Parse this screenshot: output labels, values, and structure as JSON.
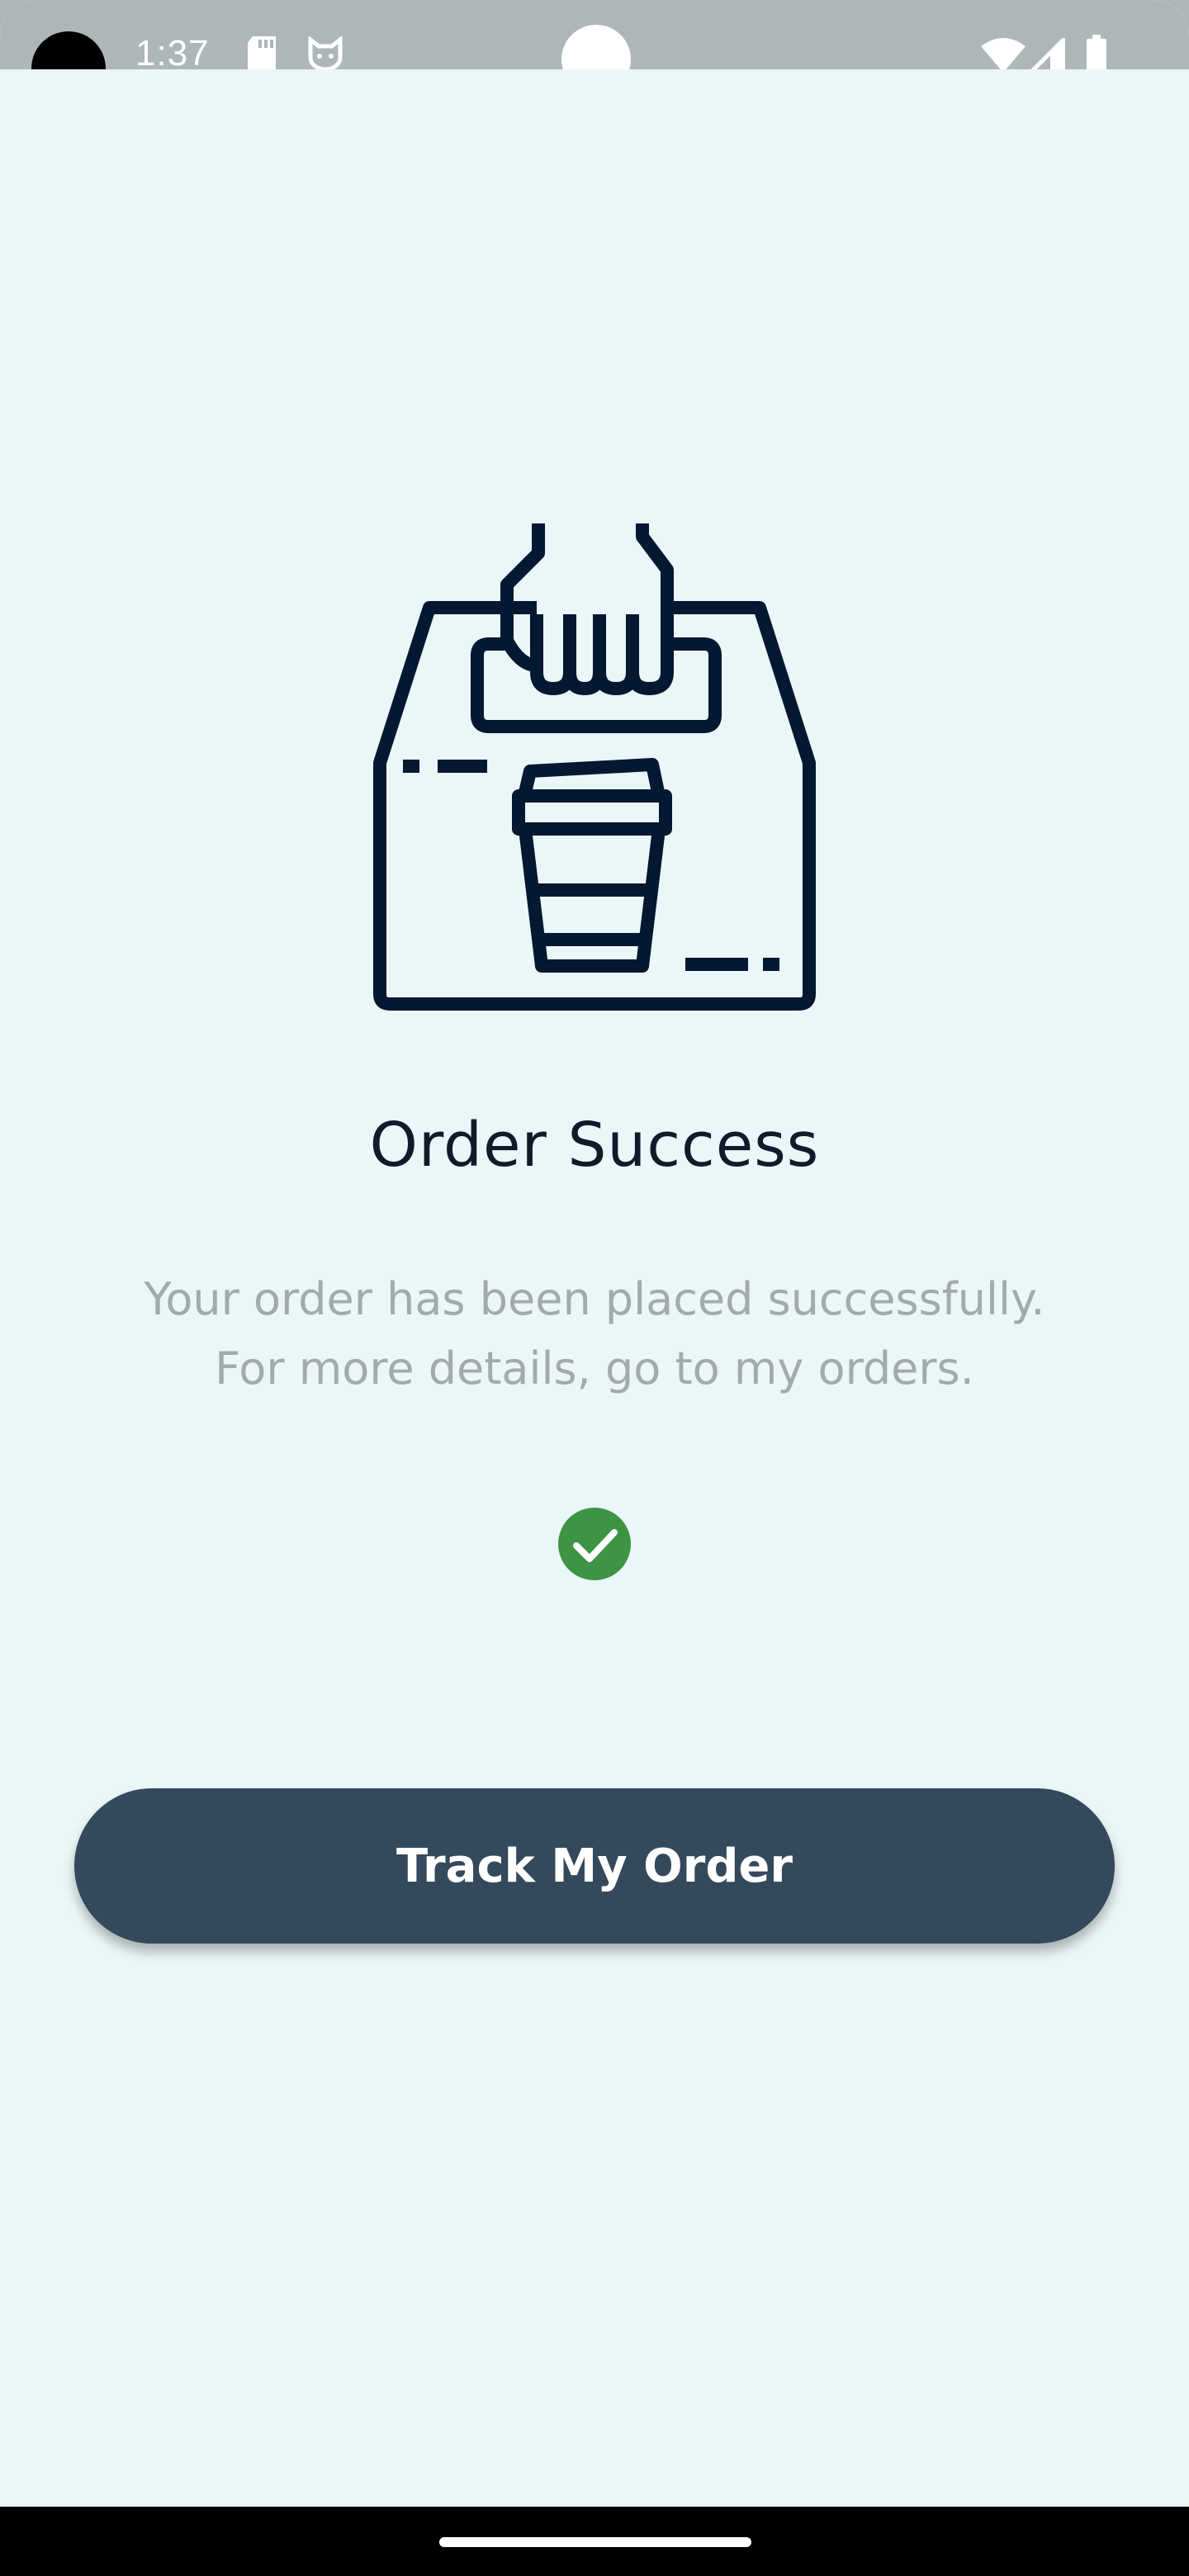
{
  "status_bar": {
    "time": "1:37",
    "icons": [
      "sd-card-icon",
      "cat-face-icon",
      "wifi-icon",
      "signal-icon",
      "battery-icon"
    ]
  },
  "hero_icon": "delivery-box-coffee-icon",
  "success_screen": {
    "title": "Order Success",
    "message_line1": "Your order has been placed successfully.",
    "message_line2": "For more details, go to my orders.",
    "check_icon": "check-circle-icon",
    "track_button_label": "Track My Order"
  },
  "colors": {
    "background": "#ebf6f8",
    "status_bar": "#adb7b9",
    "title_text": "#0f1a2b",
    "body_text": "#a3aaae",
    "success_green": "#3d9443",
    "button": "#34495b",
    "icon_stroke": "#051831"
  }
}
